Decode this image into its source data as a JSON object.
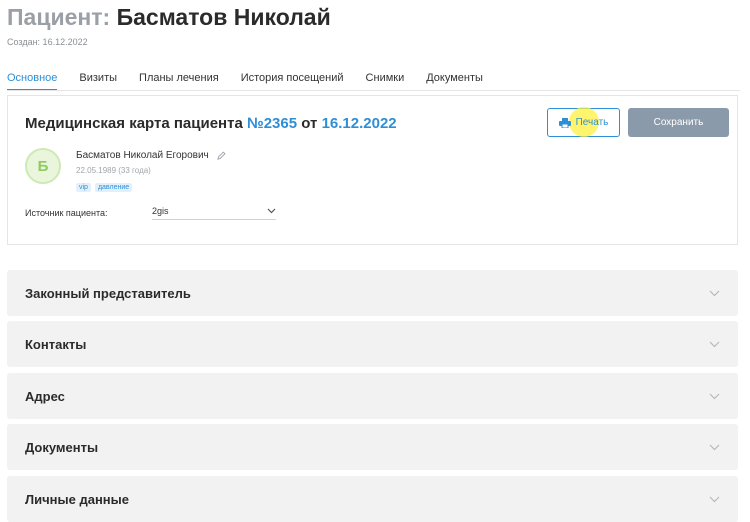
{
  "header": {
    "title_prefix": "Пациент:",
    "title_name": "Басматов Николай",
    "created": "Создан: 16.12.2022"
  },
  "tabs": [
    {
      "label": "Основное",
      "active": true
    },
    {
      "label": "Визиты"
    },
    {
      "label": "Планы лечения"
    },
    {
      "label": "История посещений"
    },
    {
      "label": "Снимки"
    },
    {
      "label": "Документы"
    }
  ],
  "card": {
    "title_text": "Медицинская карта пациента",
    "number": "№2365",
    "from_text": "от",
    "date": "16.12.2022",
    "print_label": "Печать",
    "save_label": "Сохранить",
    "avatar_letter": "Б",
    "full_name": "Басматов Николай Егорович",
    "birth": "22.05.1989 (33 года)",
    "tags": [
      "vip",
      "давление"
    ],
    "source_label": "Источник пациента:",
    "source_value": "2gis"
  },
  "sections": [
    {
      "label": "Законный представитель"
    },
    {
      "label": "Контакты"
    },
    {
      "label": "Адрес"
    },
    {
      "label": "Документы"
    },
    {
      "label": "Личные данные"
    }
  ],
  "colors": {
    "accent": "#2f8fd6",
    "save_button": "#8b9aab",
    "avatar_bg": "#e9f6dc",
    "avatar_fg": "#8fca5d",
    "section_bg": "#f2f2f3"
  },
  "icons": {
    "print": "printer-icon",
    "edit": "pencil-icon",
    "chevron": "chevron-down-icon"
  }
}
